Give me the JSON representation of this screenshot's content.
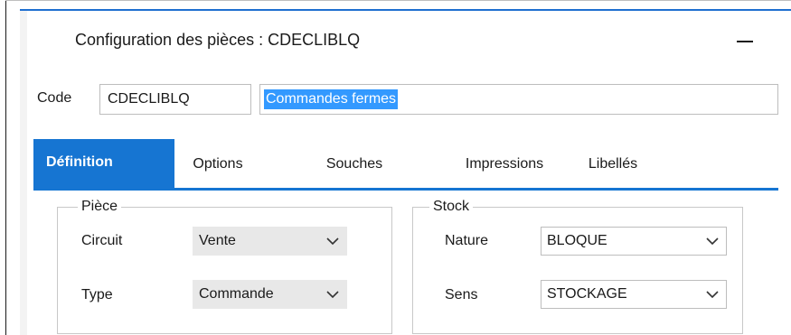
{
  "window": {
    "title": "Configuration des pièces : CDECLIBLQ"
  },
  "code": {
    "label": "Code",
    "value": "CDECLIBLQ",
    "description": "Commandes fermes"
  },
  "tabs": [
    {
      "label": "Définition",
      "active": true
    },
    {
      "label": "Options",
      "active": false
    },
    {
      "label": "Souches",
      "active": false
    },
    {
      "label": "Impressions",
      "active": false
    },
    {
      "label": "Libellés",
      "active": false
    }
  ],
  "piece": {
    "legend": "Pièce",
    "circuit_label": "Circuit",
    "circuit_value": "Vente",
    "type_label": "Type",
    "type_value": "Commande"
  },
  "stock": {
    "legend": "Stock",
    "nature_label": "Nature",
    "nature_value": "BLOQUE",
    "sens_label": "Sens",
    "sens_value": "STOCKAGE"
  },
  "colors": {
    "accent": "#1675d2",
    "selection": "#3399ff"
  },
  "icons": {
    "minimize": "minimize-icon",
    "dropdown": "chevron-down-icon"
  }
}
